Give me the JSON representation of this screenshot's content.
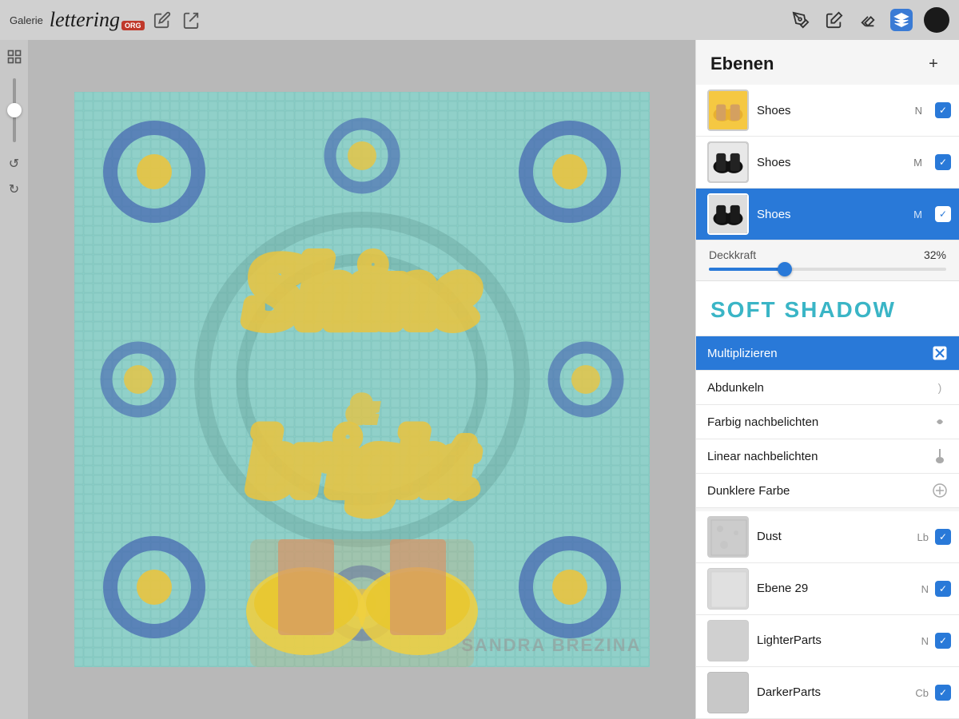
{
  "toolbar": {
    "gallery_label": "Galerie",
    "app_name": "lettering",
    "org_badge": "ORG",
    "add_icon": "✦",
    "icons": [
      "pencil",
      "pen",
      "eraser",
      "layers",
      "color"
    ]
  },
  "layers_panel": {
    "title": "Ebenen",
    "add_button": "+",
    "layers": [
      {
        "name": "Shoes",
        "mode": "N",
        "checked": true,
        "active": false,
        "thumb_type": "yellow"
      },
      {
        "name": "Shoes",
        "mode": "M",
        "checked": true,
        "active": false,
        "thumb_type": "dark"
      },
      {
        "name": "Shoes",
        "mode": "M",
        "checked": true,
        "active": true,
        "thumb_type": "selected"
      }
    ],
    "opacity": {
      "label": "Deckkraft",
      "value": "32%",
      "percent": 32
    },
    "soft_shadow_title": "SOFT SHADOW",
    "blend_modes": [
      {
        "name": "Multiplizieren",
        "active": true,
        "icon": "☑"
      },
      {
        "name": "Abdunkeln",
        "active": false,
        "icon": ")"
      },
      {
        "name": "Farbig nachbelichten",
        "active": false,
        "icon": "🌿"
      },
      {
        "name": "Linear nachbelichten",
        "active": false,
        "icon": "💧"
      },
      {
        "name": "Dunklere Farbe",
        "active": false,
        "icon": "+"
      }
    ],
    "lower_layers": [
      {
        "name": "Dust",
        "mode": "Lb",
        "checked": true,
        "thumb_type": "dust"
      },
      {
        "name": "Ebene 29",
        "mode": "N",
        "checked": true,
        "thumb_type": "ebene29"
      },
      {
        "name": "LighterParts",
        "mode": "N",
        "checked": true,
        "thumb_type": "lighterparts"
      },
      {
        "name": "DarkerParts",
        "mode": "Cb",
        "checked": true,
        "thumb_type": "darkerparts"
      }
    ]
  },
  "canvas": {
    "watermark": "Sandra Brezina"
  },
  "colors": {
    "accent": "#2979d8",
    "teal": "#3ab5c6",
    "active_bg": "#2979d8"
  }
}
